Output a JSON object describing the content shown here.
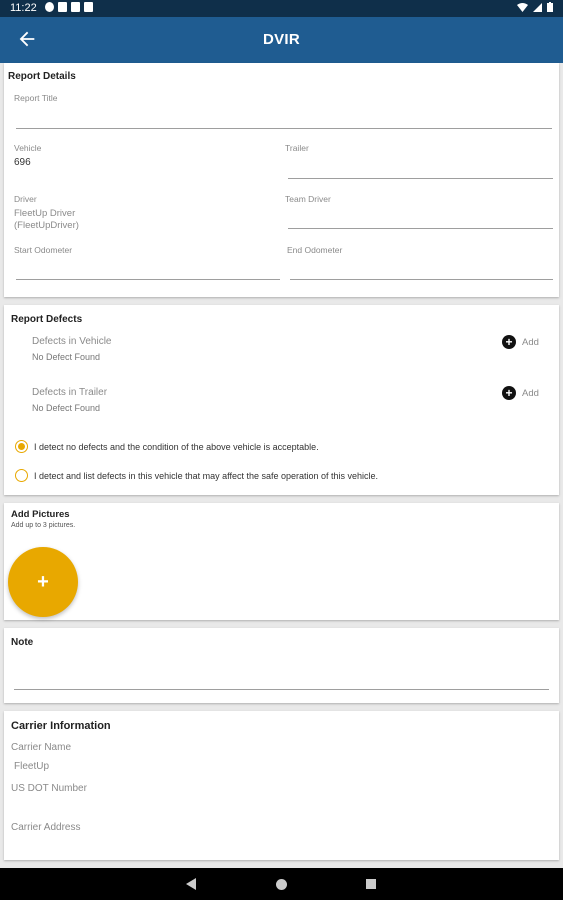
{
  "status_bar": {
    "time": "11:22"
  },
  "app_bar": {
    "title": "DVIR"
  },
  "report_details": {
    "title": "Report Details",
    "report_title_label": "Report Title",
    "report_title_value": "",
    "vehicle_label": "Vehicle",
    "vehicle_value": "696",
    "trailer_label": "Trailer",
    "trailer_value": "",
    "driver_label": "Driver",
    "driver_value_line1": "FleetUp Driver",
    "driver_value_line2": "(FleetUpDriver)",
    "team_driver_label": "Team Driver",
    "start_odometer_label": "Start Odometer",
    "end_odometer_label": "End Odometer"
  },
  "report_defects": {
    "title": "Report Defects",
    "vehicle_defects_label": "Defects in Vehicle",
    "vehicle_defects_value": "No Defect Found",
    "trailer_defects_label": "Defects in Trailer",
    "trailer_defects_value": "No Defect Found",
    "add_label": "Add",
    "option_no_defects": "I detect no defects and the condition of the above vehicle is acceptable.",
    "option_list_defects": "I detect and list defects in this vehicle that may affect the safe operation of this vehicle.",
    "selected_option": "no_defects"
  },
  "add_pictures": {
    "title": "Add Pictures",
    "hint": "Add up to 3 pictures.",
    "add_symbol": "+"
  },
  "note": {
    "title": "Note",
    "value": ""
  },
  "carrier_info": {
    "title": "Carrier Information",
    "carrier_name_label": "Carrier Name",
    "carrier_name_value": "FleetUp",
    "us_dot_label": "US DOT Number",
    "us_dot_value": "",
    "carrier_address_label": "Carrier Address",
    "carrier_address_value": ""
  },
  "colors": {
    "app_bar": "#1f5c91",
    "status_bar": "#0f2f4a",
    "accent": "#e8a800"
  }
}
